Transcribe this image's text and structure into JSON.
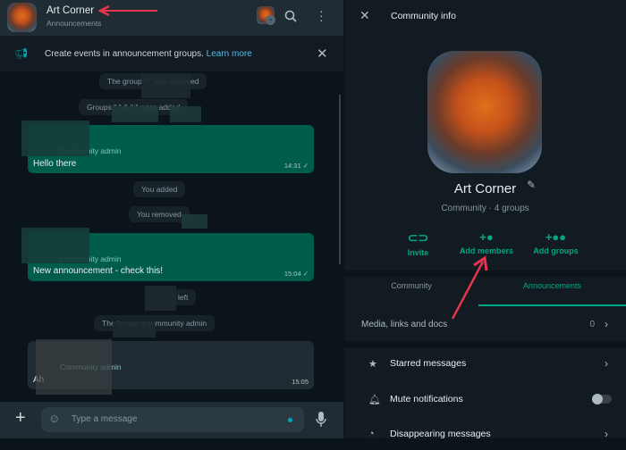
{
  "chat_header": {
    "title": "Art Corner",
    "subtitle": "Announcements"
  },
  "banner": {
    "text": "Create events in announcement groups.",
    "link": "Learn more"
  },
  "messages": {
    "sys1": "The group \"          \" was removed",
    "sys2": "Groups \"          \" & \"          \" were added",
    "m1": {
      "sender_role": "Community admin",
      "text": "Hello there",
      "time": "14:31"
    },
    "sys3": "You added",
    "sys4": "You removed",
    "m2": {
      "sender_role": "Community admin",
      "text": "New announcement - check this!",
      "time": "15:04"
    },
    "sys5": "left",
    "sys6": "The            is now a community admin",
    "m3": {
      "sender_role": "Community admin",
      "text": "Ah",
      "time": "15:05"
    }
  },
  "input": {
    "placeholder": "Type a message"
  },
  "info": {
    "title": "Community info",
    "name": "Art Corner",
    "subtitle": "Community · 4 groups",
    "actions": [
      "Invite",
      "Add members",
      "Add groups"
    ],
    "tabs": [
      "Community",
      "Announcements"
    ],
    "active_tab": "Announcements",
    "media": {
      "label": "Media, links and docs",
      "count": "0"
    },
    "rows": [
      "Starred messages",
      "Mute notifications",
      "Disappearing messages"
    ],
    "mute_on": false
  },
  "colors": {
    "accent": "#00a884",
    "annotation": "#e8344e"
  }
}
